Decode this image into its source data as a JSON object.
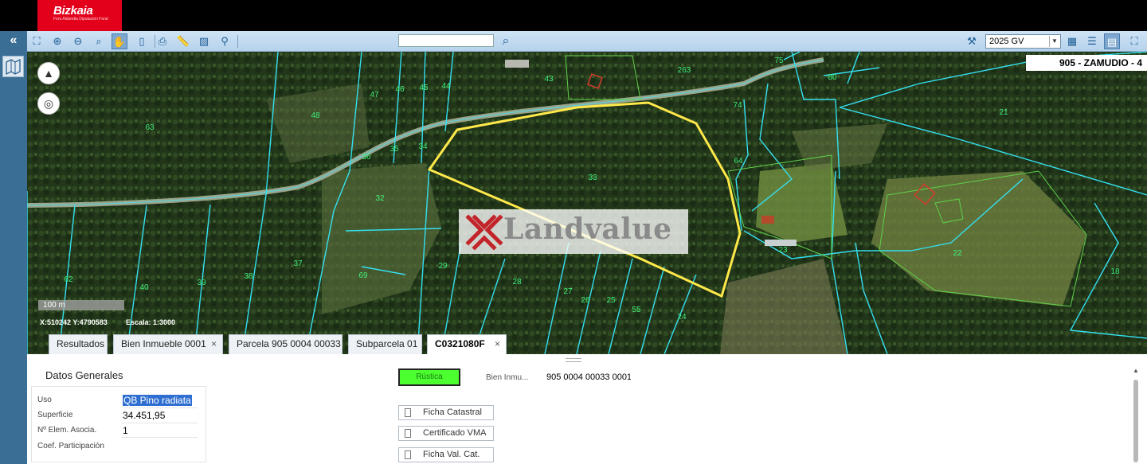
{
  "brand": {
    "name": "Bizkaia",
    "subline": "Foru Aldundia Diputación Foral"
  },
  "toolbar": {
    "collapse_glyph": "«",
    "tools": [
      {
        "name": "zoom-extent-icon",
        "glyph": "⛶"
      },
      {
        "name": "zoom-in-icon",
        "glyph": "⊕"
      },
      {
        "name": "zoom-out-icon",
        "glyph": "⊖"
      },
      {
        "name": "zoom-rect-icon",
        "glyph": "⌕"
      },
      {
        "name": "pan-hand-icon",
        "glyph": "✋",
        "active": true
      },
      {
        "name": "info-icon",
        "glyph": "▯"
      },
      {
        "name": "print-icon",
        "glyph": "⎙"
      },
      {
        "name": "measure-icon",
        "glyph": "📏"
      },
      {
        "name": "hatch-icon",
        "glyph": "▨"
      },
      {
        "name": "person-search-icon",
        "glyph": "⚲"
      }
    ],
    "search": {
      "placeholder": "",
      "value": ""
    },
    "right_tools": [
      {
        "name": "broom-icon",
        "glyph": "⚒"
      },
      {
        "name": "table-icon",
        "glyph": "▦"
      },
      {
        "name": "list-icon",
        "glyph": "☰"
      },
      {
        "name": "layers-icon",
        "glyph": "▤",
        "active": true
      },
      {
        "name": "fullscreen-icon",
        "glyph": "⛶"
      }
    ],
    "year_select": {
      "selected": "2025 GV"
    }
  },
  "map": {
    "municipality": "905 - ZAMUDIO - 4",
    "scale_bar": "100 m",
    "coords": "X:510242 Y:4790583",
    "scale": "Escala: 1:3000",
    "watermark": "Landvalue",
    "parcel_labels": [
      {
        "t": "63"
      },
      {
        "t": "47"
      },
      {
        "t": "46"
      },
      {
        "t": "45"
      },
      {
        "t": "44"
      },
      {
        "t": "43"
      },
      {
        "t": "263"
      },
      {
        "t": "75"
      },
      {
        "t": "80"
      },
      {
        "t": "48"
      },
      {
        "t": "74"
      },
      {
        "t": "21"
      },
      {
        "t": "35"
      },
      {
        "t": "34"
      },
      {
        "t": "36"
      },
      {
        "t": "64"
      },
      {
        "t": "33"
      },
      {
        "t": "32"
      },
      {
        "t": "37"
      },
      {
        "t": "38"
      },
      {
        "t": "39"
      },
      {
        "t": "62"
      },
      {
        "t": "40"
      },
      {
        "t": "69"
      },
      {
        "t": "29"
      },
      {
        "t": "28"
      },
      {
        "t": "27"
      },
      {
        "t": "26"
      },
      {
        "t": "25"
      },
      {
        "t": "55"
      },
      {
        "t": "24"
      },
      {
        "t": "23"
      },
      {
        "t": "22"
      },
      {
        "t": "18"
      }
    ],
    "colors": {
      "parcel_line": "#34e0f0",
      "selected_outline": "#ffe94a",
      "label": "#3ff07a",
      "building": "#d43b2c"
    }
  },
  "tabs": [
    {
      "label": "Resultados",
      "closable": false
    },
    {
      "label": "Bien Inmueble 0001",
      "closable": true
    },
    {
      "label": "Parcela 905 0004 00033",
      "closable": false
    },
    {
      "label": "Subparcela 01",
      "closable": false
    },
    {
      "label": "C0321080F",
      "closable": true,
      "active": true
    }
  ],
  "tab_close_glyph": "×",
  "details": {
    "section_title": "Datos Generales",
    "rows": [
      {
        "label": "Uso",
        "value": "QB  Pino radiata"
      },
      {
        "label": "Superficie",
        "value": "34.451,95"
      },
      {
        "label": "Nº Elem. Asocia.",
        "value": "1"
      },
      {
        "label": "Coef. Participación",
        "value": ""
      }
    ],
    "status_badge": "Rústica",
    "bien_label": "Bien Inmu...",
    "bien_value": "905 0004 00033 0001",
    "buttons": [
      "Ficha Catastral",
      "Certificado VMA",
      "Ficha Val. Cat."
    ]
  }
}
